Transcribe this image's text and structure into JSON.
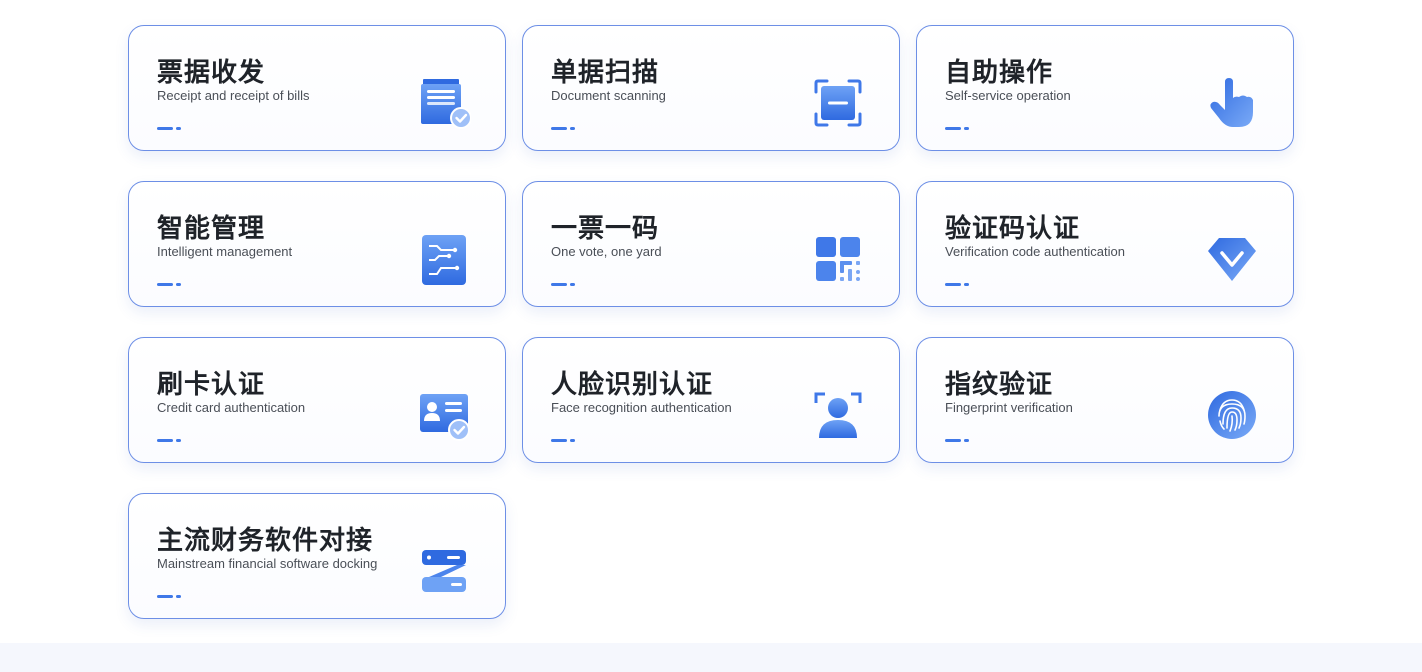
{
  "cards": [
    {
      "title": "票据收发",
      "subtitle": "Receipt and receipt of bills",
      "icon": "bill-tray-icon"
    },
    {
      "title": "单据扫描",
      "subtitle": "Document scanning",
      "icon": "scan-frame-icon"
    },
    {
      "title": "自助操作",
      "subtitle": "Self-service operation",
      "icon": "pointing-hand-icon"
    },
    {
      "title": "智能管理",
      "subtitle": "Intelligent management",
      "icon": "circuit-doc-icon"
    },
    {
      "title": "一票一码",
      "subtitle": "One vote, one yard",
      "icon": "qr-code-icon"
    },
    {
      "title": "验证码认证",
      "subtitle": "Verification code authentication",
      "icon": "diamond-check-icon"
    },
    {
      "title": "刷卡认证",
      "subtitle": "Credit card authentication",
      "icon": "id-card-check-icon"
    },
    {
      "title": "人脸识别认证",
      "subtitle": "Face recognition authentication",
      "icon": "face-scan-icon"
    },
    {
      "title": "指纹验证",
      "subtitle": "Fingerprint verification",
      "icon": "fingerprint-icon"
    },
    {
      "title": "主流财务软件对接",
      "subtitle": "Mainstream financial software docking",
      "icon": "software-docking-icon"
    }
  ],
  "colors": {
    "accent": "#3f78e8",
    "icon_light": "#6ea2f5",
    "icon_dark": "#2f6ae0",
    "card_border": "#6d8fe6",
    "title": "#1f2329",
    "subtitle": "#4a4f57",
    "footer_band": "#f5f7fd"
  }
}
